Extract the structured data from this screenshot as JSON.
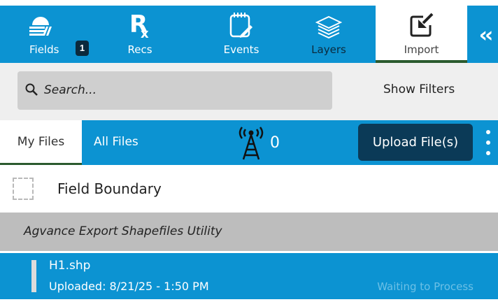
{
  "nav": {
    "fields_label": "Fields",
    "fields_badge": "1",
    "recs_label": "Recs",
    "events_label": "Events",
    "layers_label": "Layers",
    "import_label": "Import",
    "collapse_glyph": "‹‹",
    "icons": {
      "fields": "fields-icon",
      "recs": "rx-icon",
      "events": "events-icon",
      "layers": "layers-icon",
      "import": "import-icon"
    }
  },
  "search": {
    "placeholder": "Search...",
    "show_filters": "Show Filters"
  },
  "files_tabs": {
    "my_files": "My Files",
    "all_files": "All Files",
    "connection_count": "0",
    "upload_label": "Upload File(s)"
  },
  "field_boundary": {
    "label": "Field Boundary"
  },
  "group": {
    "title": "Agvance Export Shapefiles Utility"
  },
  "file_item": {
    "name": "H1.shp",
    "uploaded": "Uploaded: 8/21/25 - 1:50 PM",
    "status": "Waiting to Process"
  },
  "colors": {
    "primary_blue": "#0c93d2",
    "dark_navy": "#0b3a57",
    "active_underline": "#2b5a2e",
    "group_gray": "#bdbdbd",
    "status_text": "#6cc0e6"
  }
}
